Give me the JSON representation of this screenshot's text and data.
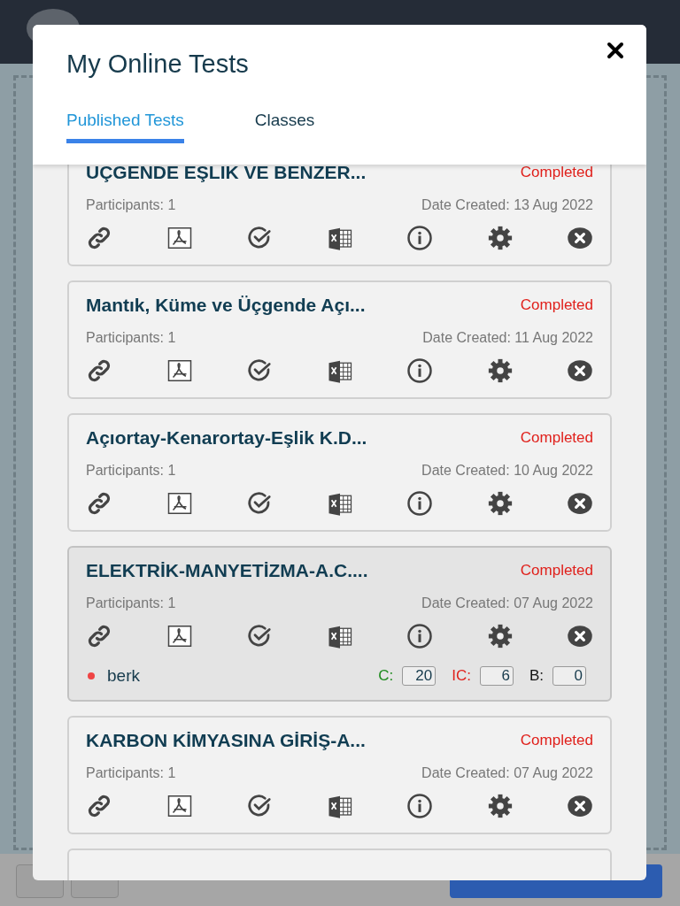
{
  "dialog": {
    "title": "My Online Tests",
    "tabs": [
      {
        "label": "Published Tests",
        "selected": true
      },
      {
        "label": "Classes",
        "selected": false
      }
    ],
    "tests": [
      {
        "title": "UÇGENDE EŞLIK VE BENZER...",
        "status": "Completed",
        "participants": "Participants: 1",
        "date_created": "Date Created: 13 Aug 2022",
        "selected": false
      },
      {
        "title": "Mantık, Küme ve Üçgende Açı...",
        "status": "Completed",
        "participants": "Participants: 1",
        "date_created": "Date Created: 11 Aug 2022",
        "selected": false
      },
      {
        "title": "Açıortay-Kenarortay-Eşlik K.D...",
        "status": "Completed",
        "participants": "Participants: 1",
        "date_created": "Date Created: 10 Aug 2022",
        "selected": false
      },
      {
        "title": "ELEKTRİK-MANYETİZMA-A.C....",
        "status": "Completed",
        "participants": "Participants: 1",
        "date_created": "Date Created: 07 Aug 2022",
        "selected": true,
        "results": [
          {
            "name": "berk",
            "color": "#ef4444",
            "scores": [
              {
                "kind": "correct",
                "label": "C:",
                "value": "20"
              },
              {
                "kind": "incorrect",
                "label": "IC:",
                "value": "6"
              },
              {
                "kind": "blank",
                "label": "B:",
                "value": "0"
              }
            ]
          }
        ]
      },
      {
        "title": "KARBON KİMYASINA GİRİŞ-A...",
        "status": "Completed",
        "participants": "Participants: 1",
        "date_created": "Date Created: 07 Aug 2022",
        "selected": false
      }
    ]
  }
}
